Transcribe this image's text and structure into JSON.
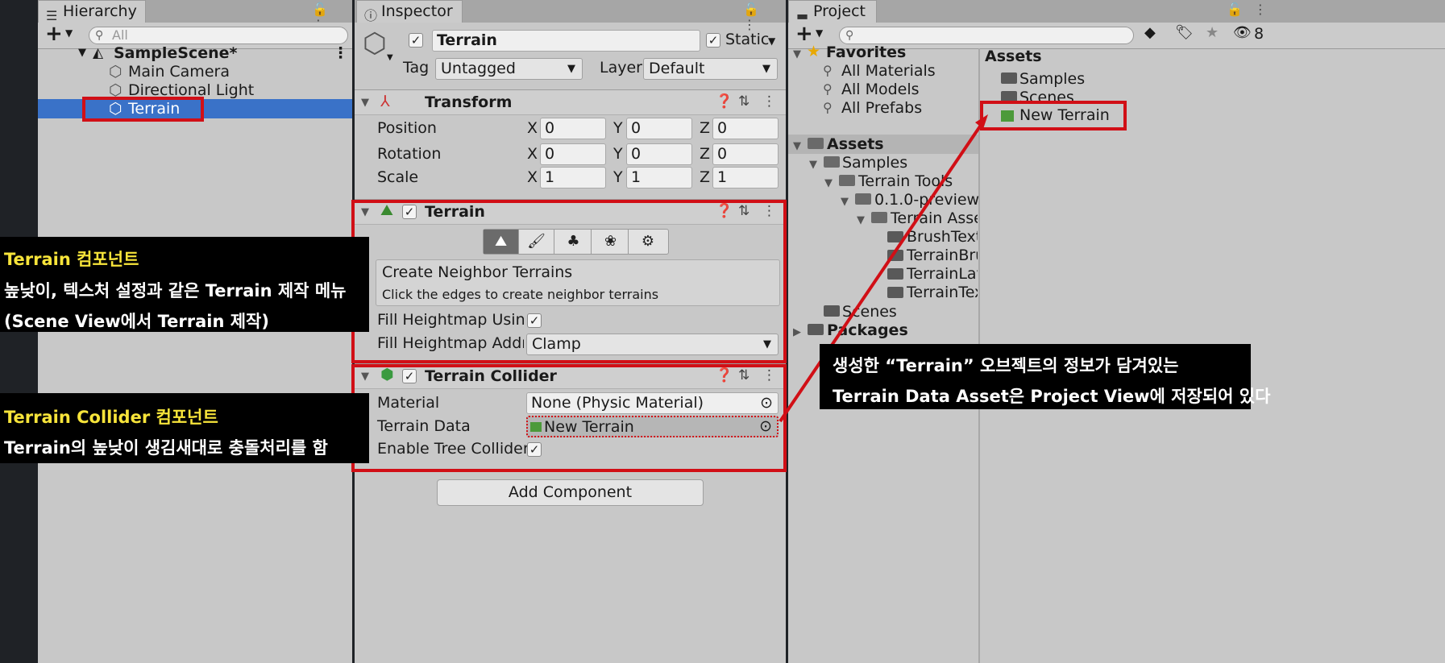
{
  "hierarchy": {
    "tab_label": "Hierarchy",
    "search_placeholder": "All",
    "scene_name": "SampleScene*",
    "items": [
      "Main Camera",
      "Directional Light",
      "Terrain"
    ]
  },
  "inspector": {
    "tab_label": "Inspector",
    "object_name": "Terrain",
    "static_label": "Static",
    "tag_label": "Tag",
    "tag_value": "Untagged",
    "layer_label": "Layer",
    "layer_value": "Default",
    "transform": {
      "title": "Transform",
      "position_label": "Position",
      "rotation_label": "Rotation",
      "scale_label": "Scale",
      "position": [
        "0",
        "0",
        "0"
      ],
      "rotation": [
        "0",
        "0",
        "0"
      ],
      "scale": [
        "1",
        "1",
        "1"
      ],
      "axes": [
        "X",
        "Y",
        "Z"
      ]
    },
    "terrain": {
      "title": "Terrain",
      "neighbor_title": "Create Neighbor Terrains",
      "neighbor_hint": "Click the edges to create neighbor terrains",
      "fill_using_label": "Fill Heightmap Using I",
      "fill_address_label": "Fill Heightmap Addres",
      "fill_address_value": "Clamp"
    },
    "collider": {
      "title": "Terrain Collider",
      "material_label": "Material",
      "material_value": "None (Physic Material)",
      "terrain_data_label": "Terrain Data",
      "terrain_data_value": "New Terrain",
      "enable_trees_label": "Enable Tree Colliders"
    },
    "add_component": "Add Component"
  },
  "project": {
    "tab_label": "Project",
    "hidden_count": "8",
    "favorites": {
      "label": "Favorites",
      "items": [
        "All Materials",
        "All Models",
        "All Prefabs"
      ]
    },
    "tree": {
      "assets": "Assets",
      "samples": "Samples",
      "terrain_tools": "Terrain Tools",
      "preview": "0.1.0-preview",
      "terrain_assets": "Terrain Asset",
      "sub": [
        "BrushTextu",
        "TerrainBru",
        "TerrainLay",
        "TerrainTex"
      ],
      "scenes": "Scenes",
      "packages": "Packages"
    },
    "assets_header": "Assets",
    "assets_items": [
      "Samples",
      "Scenes",
      "New Terrain"
    ]
  },
  "annotations": {
    "terrain_title_en": "Terrain",
    "terrain_title_ko": " 컴포넌트",
    "terrain_line2": "높낮이, 텍스처 설정과 같은 Terrain 제작 메뉴",
    "terrain_line3": "(Scene View에서 Terrain 제작)",
    "collider_title_en": "Terrain Collider",
    "collider_title_ko": " 컴포넌트",
    "collider_line2": "Terrain의 높낮이 생김새대로 충돌처리를 함",
    "project_line1": "생성한 “Terrain” 오브젝트의 정보가 담겨있는",
    "project_line2": "Terrain Data Asset은 Project View에 저장되어 있다"
  },
  "colors": {
    "highlight_red": "#d10f16",
    "selection_blue": "#3a72c8",
    "annotation_yellow": "#f7e43a"
  }
}
